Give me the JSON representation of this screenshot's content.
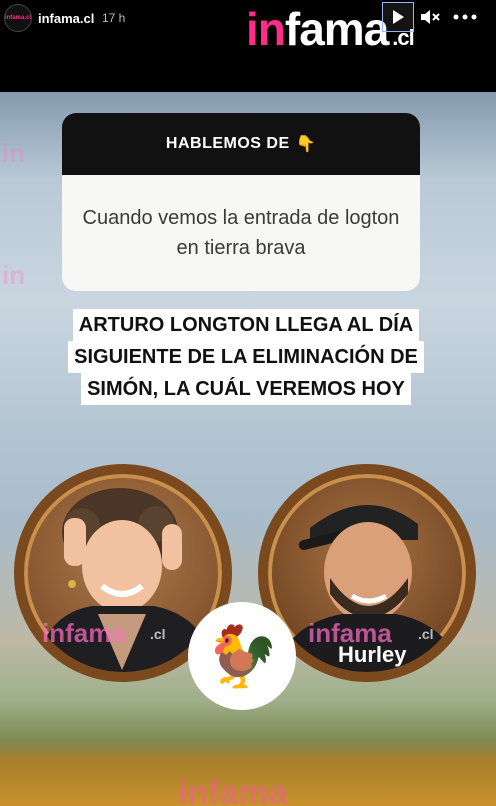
{
  "header": {
    "avatar_text": "infama.cl",
    "username": "infama.cl",
    "time": "17 h",
    "logo_in": "in",
    "logo_fama": "fama",
    "logo_cl": ".cl"
  },
  "watermark": {
    "in": "in",
    "infama": "infama",
    "cl": ".cl"
  },
  "question": {
    "header": "HABLEMOS DE",
    "header_emoji": "👇",
    "body": "Cuando vemos la entrada de logton en tierra brava"
  },
  "headline": {
    "line1": "ARTURO LONGTON LLEGA AL DÍA",
    "line2": "SIGUIENTE DE LA ELIMINACIÓN DE",
    "line3": "SIMÓN,  LA CUÁL VEREMOS HOY"
  },
  "shirt_text": "Hurley",
  "rooster_emoji": "🐓",
  "colors": {
    "accent": "#ff2c8a",
    "frame": "#7a4a1e"
  }
}
